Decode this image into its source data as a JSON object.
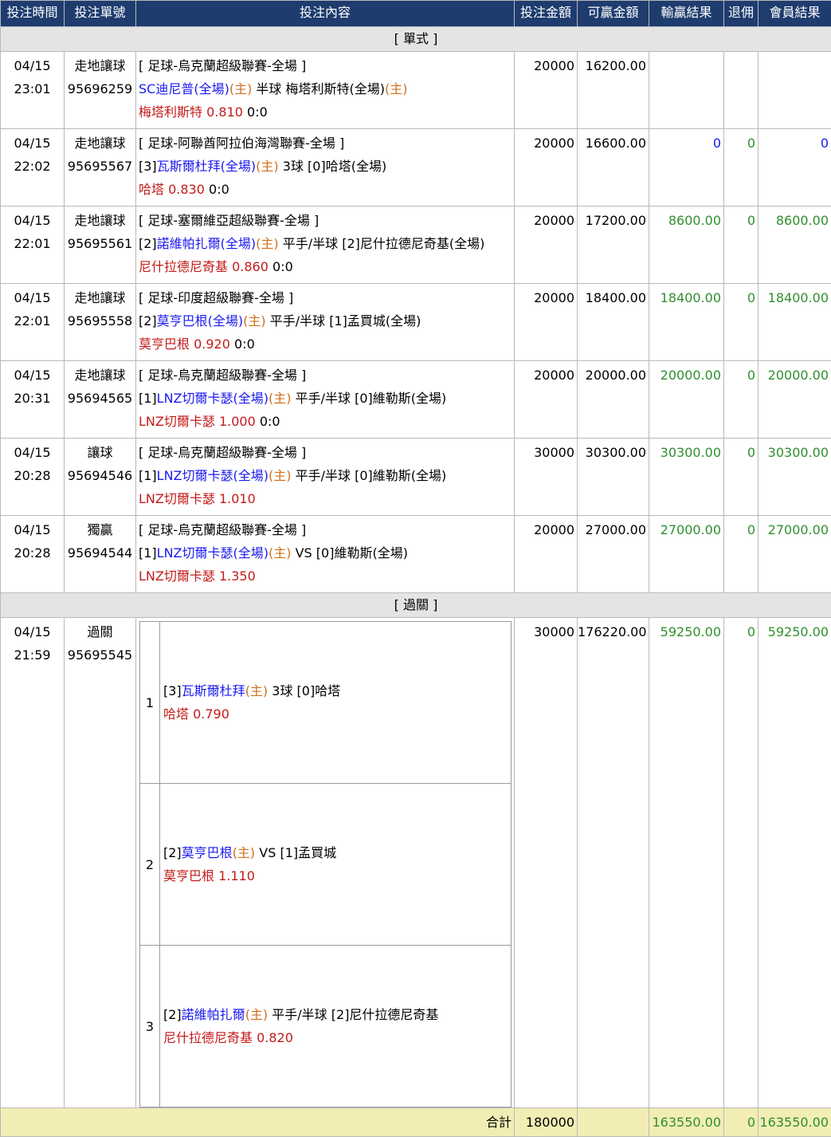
{
  "headers": {
    "time": "投注時間",
    "id": "投注單號",
    "content": "投注內容",
    "amount": "投注金額",
    "win": "可贏金額",
    "result": "輸贏結果",
    "rebate": "退佣",
    "member": "會員結果"
  },
  "sections": {
    "single": "[ 單式 ]",
    "parlay": "[ 過關 ]"
  },
  "bets": [
    {
      "date": "04/15",
      "time": "23:01",
      "type": "走地讓球",
      "id": "95696259",
      "league": "[ 足球-烏克蘭超級聯賽-全場 ]",
      "prefix_home": "",
      "home": "SC迪尼普(全場)",
      "main": "(主)",
      "handicap": " 半球 ",
      "away": "梅塔利斯特(全場)",
      "away_tag": "(主)",
      "pick": "梅塔利斯特",
      "odds": "0.810",
      "score": " 0:0",
      "amount": "20000",
      "win": "16200.00",
      "result": "",
      "rebate": "",
      "member": ""
    },
    {
      "date": "04/15",
      "time": "22:02",
      "type": "走地讓球",
      "id": "95695567",
      "league": "[ 足球-阿聯酋阿拉伯海灣聯賽-全場 ]",
      "prefix_home": "[3]",
      "home": "瓦斯爾杜拜(全場)",
      "main": "(主)",
      "handicap": " 3球 ",
      "away": "[0]哈塔(全場)",
      "away_tag": "",
      "pick": "哈塔",
      "odds": "0.830",
      "score": " 0:0",
      "amount": "20000",
      "win": "16600.00",
      "result": "0",
      "rebate": "0",
      "member": "0"
    },
    {
      "date": "04/15",
      "time": "22:01",
      "type": "走地讓球",
      "id": "95695561",
      "league": "[ 足球-塞爾維亞超級聯賽-全場 ]",
      "prefix_home": "[2]",
      "home": "諾維帕扎爾(全場)",
      "main": "(主)",
      "handicap": " 平手/半球 ",
      "away": "[2]尼什拉德尼奇基(全場)",
      "away_tag": "",
      "pick": "尼什拉德尼奇基",
      "odds": "0.860",
      "score": " 0:0",
      "amount": "20000",
      "win": "17200.00",
      "result": "8600.00",
      "rebate": "0",
      "member": "8600.00"
    },
    {
      "date": "04/15",
      "time": "22:01",
      "type": "走地讓球",
      "id": "95695558",
      "league": "[ 足球-印度超級聯賽-全場 ]",
      "prefix_home": "[2]",
      "home": "莫亨巴根(全場)",
      "main": "(主)",
      "handicap": " 平手/半球 ",
      "away": "[1]孟買城(全場)",
      "away_tag": "",
      "pick": "莫亨巴根",
      "odds": "0.920",
      "score": " 0:0",
      "amount": "20000",
      "win": "18400.00",
      "result": "18400.00",
      "rebate": "0",
      "member": "18400.00"
    },
    {
      "date": "04/15",
      "time": "20:31",
      "type": "走地讓球",
      "id": "95694565",
      "league": "[ 足球-烏克蘭超級聯賽-全場 ]",
      "prefix_home": "[1]",
      "home": "LNZ切爾卡瑟(全場)",
      "main": "(主)",
      "handicap": " 平手/半球 ",
      "away": "[0]維勒斯(全場)",
      "away_tag": "",
      "pick": "LNZ切爾卡瑟",
      "odds": "1.000",
      "score": " 0:0",
      "amount": "20000",
      "win": "20000.00",
      "result": "20000.00",
      "rebate": "0",
      "member": "20000.00"
    },
    {
      "date": "04/15",
      "time": "20:28",
      "type": "讓球",
      "id": "95694546",
      "league": "[ 足球-烏克蘭超級聯賽-全場 ]",
      "prefix_home": "[1]",
      "home": "LNZ切爾卡瑟(全場)",
      "main": "(主)",
      "handicap": " 平手/半球 ",
      "away": "[0]維勒斯(全場)",
      "away_tag": "",
      "pick": "LNZ切爾卡瑟",
      "odds": "1.010",
      "score": "",
      "amount": "30000",
      "win": "30300.00",
      "result": "30300.00",
      "rebate": "0",
      "member": "30300.00"
    },
    {
      "date": "04/15",
      "time": "20:28",
      "type": "獨贏",
      "id": "95694544",
      "league": "[ 足球-烏克蘭超級聯賽-全場 ]",
      "prefix_home": "[1]",
      "home": "LNZ切爾卡瑟(全場)",
      "main": "(主)",
      "handicap": " VS ",
      "away": "[0]維勒斯(全場)",
      "away_tag": "",
      "pick": "LNZ切爾卡瑟",
      "odds": "1.350",
      "score": "",
      "amount": "20000",
      "win": "27000.00",
      "result": "27000.00",
      "rebate": "0",
      "member": "27000.00"
    }
  ],
  "parlay": {
    "date": "04/15",
    "time": "21:59",
    "type": "過關",
    "id": "95695545",
    "amount": "30000",
    "win": "176220.00",
    "result": "59250.00",
    "rebate": "0",
    "member": "59250.00",
    "legs": [
      {
        "no": "1",
        "prefix_home": "[3]",
        "home": "瓦斯爾杜拜",
        "main": "(主)",
        "handicap": " 3球 ",
        "away": "[0]哈塔",
        "pick": "哈塔",
        "odds": "0.790"
      },
      {
        "no": "2",
        "prefix_home": "[2]",
        "home": "莫亨巴根",
        "main": "(主)",
        "handicap": " VS ",
        "away": "[1]孟買城",
        "pick": "莫亨巴根",
        "odds": "1.110"
      },
      {
        "no": "3",
        "prefix_home": "[2]",
        "home": "諾維帕扎爾",
        "main": "(主)",
        "handicap": " 平手/半球 ",
        "away": "[2]尼什拉德尼奇基",
        "pick": "尼什拉德尼奇基",
        "odds": "0.820"
      }
    ]
  },
  "total": {
    "label": "合計",
    "amount": "180000",
    "win": "",
    "result": "163550.00",
    "rebate": "0",
    "member": "163550.00"
  },
  "colors": {
    "header_bg": "#1e3c6e",
    "section_bg": "#e4e4e4",
    "total_bg": "#f2edb4",
    "team_blue": "#1a1af0",
    "home_tag_orange": "#d06f1a",
    "pick_red": "#c41a1a",
    "result_green": "#2f8f2f",
    "zero_blue": "#1a1af0"
  }
}
